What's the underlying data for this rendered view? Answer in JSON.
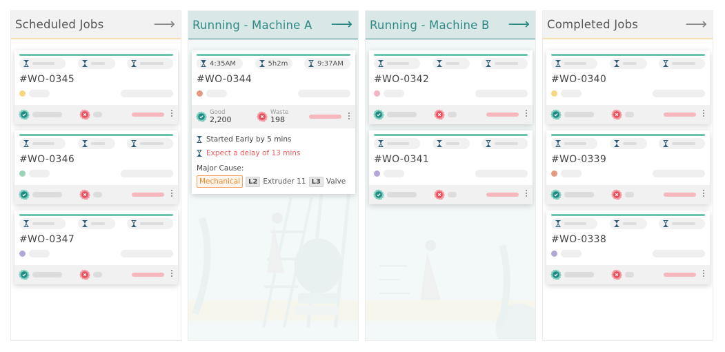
{
  "columns": [
    {
      "title": "Scheduled Jobs",
      "variant": "default",
      "cards": [
        {
          "wo": "#WO-0345",
          "dot_color": "#f9d77e"
        },
        {
          "wo": "#WO-0346",
          "dot_color": "#9bd3b6"
        },
        {
          "wo": "#WO-0347",
          "dot_color": "#b3a6d8"
        }
      ]
    },
    {
      "title": "Running - Machine A",
      "variant": "running",
      "cards": [
        {
          "wo": "#WO-0344",
          "dot_color": "#e39a80",
          "expanded": true,
          "start_time": "4:35AM",
          "duration": "5h2m",
          "end_time": "9:37AM",
          "good_label": "Good",
          "good_value": "2,200",
          "waste_label": "Waste",
          "waste_value": "198",
          "note_started": "Started Early by 5 mins",
          "note_delay": "Expect a delay of 13 mins",
          "cause_label": "Major Cause:",
          "cause_tag": "Mechanical",
          "l2_badge": "L2",
          "l2_text": "Extruder 11",
          "l3_badge": "L3",
          "l3_text": "Valve"
        }
      ]
    },
    {
      "title": "Running - Machine B",
      "variant": "running",
      "cards": [
        {
          "wo": "#WO-0342",
          "dot_color": "#f5b3c3"
        },
        {
          "wo": "#WO-0341",
          "dot_color": "#b3a6d8"
        }
      ]
    },
    {
      "title": "Completed Jobs",
      "variant": "default",
      "cards": [
        {
          "wo": "#WO-0340",
          "dot_color": "#f9d77e"
        },
        {
          "wo": "#WO-0339",
          "dot_color": "#e39a80"
        },
        {
          "wo": "#WO-0338",
          "dot_color": "#b3a6d8"
        }
      ]
    }
  ],
  "icons": {
    "header_arrow": "arrow-right",
    "time_start": "hourglass-start",
    "time_duration": "hourglass-half",
    "time_end": "hourglass-end",
    "good": "check-badge",
    "waste": "x-badge",
    "menu": "kebab-menu"
  },
  "colors": {
    "accent_teal": "#2f8a86",
    "progress_bar": "#6cc3ae",
    "waste_red": "#ec5f5f",
    "good_green": "#1e8a84",
    "header_underline": "#f5dfae",
    "mechanical_orange": "#f08a2c"
  }
}
